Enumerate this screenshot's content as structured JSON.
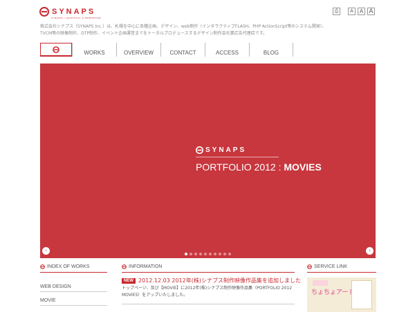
{
  "brand": {
    "name": "SYNAPS",
    "tagline": "SYNAPSE / GRAPHICAL & WEBDESIGN",
    "color": "#c8272d"
  },
  "toolbar": {
    "print_label": "⎙",
    "size_small": "A",
    "size_medium": "A",
    "size_large": "A"
  },
  "description": "株式会社シナプス（SYNAPS Inc.）は、札幌を中心に各種企画、デザイン、web制作（インタラクティブFLASH、PHP·ActionScript等のシステム開発）、TVCM等の映像制作、DTP制作、イベント企画運営までをトータルプロデュースするデザイン制作会社業広告代理店です。",
  "nav": {
    "items": [
      "WORKS",
      "OVERVIEW",
      "CONTACT",
      "ACCESS",
      "BLOG"
    ]
  },
  "hero": {
    "bg_color": "#c8373e",
    "logo_text": "SYNAPS",
    "title_main": "PORTFOLIO 2012 : ",
    "title_bold": "MOVIES",
    "prev_label": "‹",
    "next_label": "›",
    "slide_count": 10,
    "active_slide": 0
  },
  "sections": {
    "works": {
      "title": "INDEX OF WORKS",
      "items": [
        "WEB DESIGN",
        "MOVIE"
      ]
    },
    "info": {
      "title": "INFORMATION",
      "news": [
        {
          "badge": "NEW",
          "title": "2012.12.03 2012年(株)シナプス制作映像作品集を追加しました",
          "body": "トップページ、及び【MOVIE】に2012年(株)シナプス制作映像作品集（PORTFOLIO 2012 MOVIES）をアップいたしました。"
        }
      ]
    },
    "service": {
      "title": "SERVICE LINK",
      "banner_text": "ちょちょアート"
    }
  }
}
